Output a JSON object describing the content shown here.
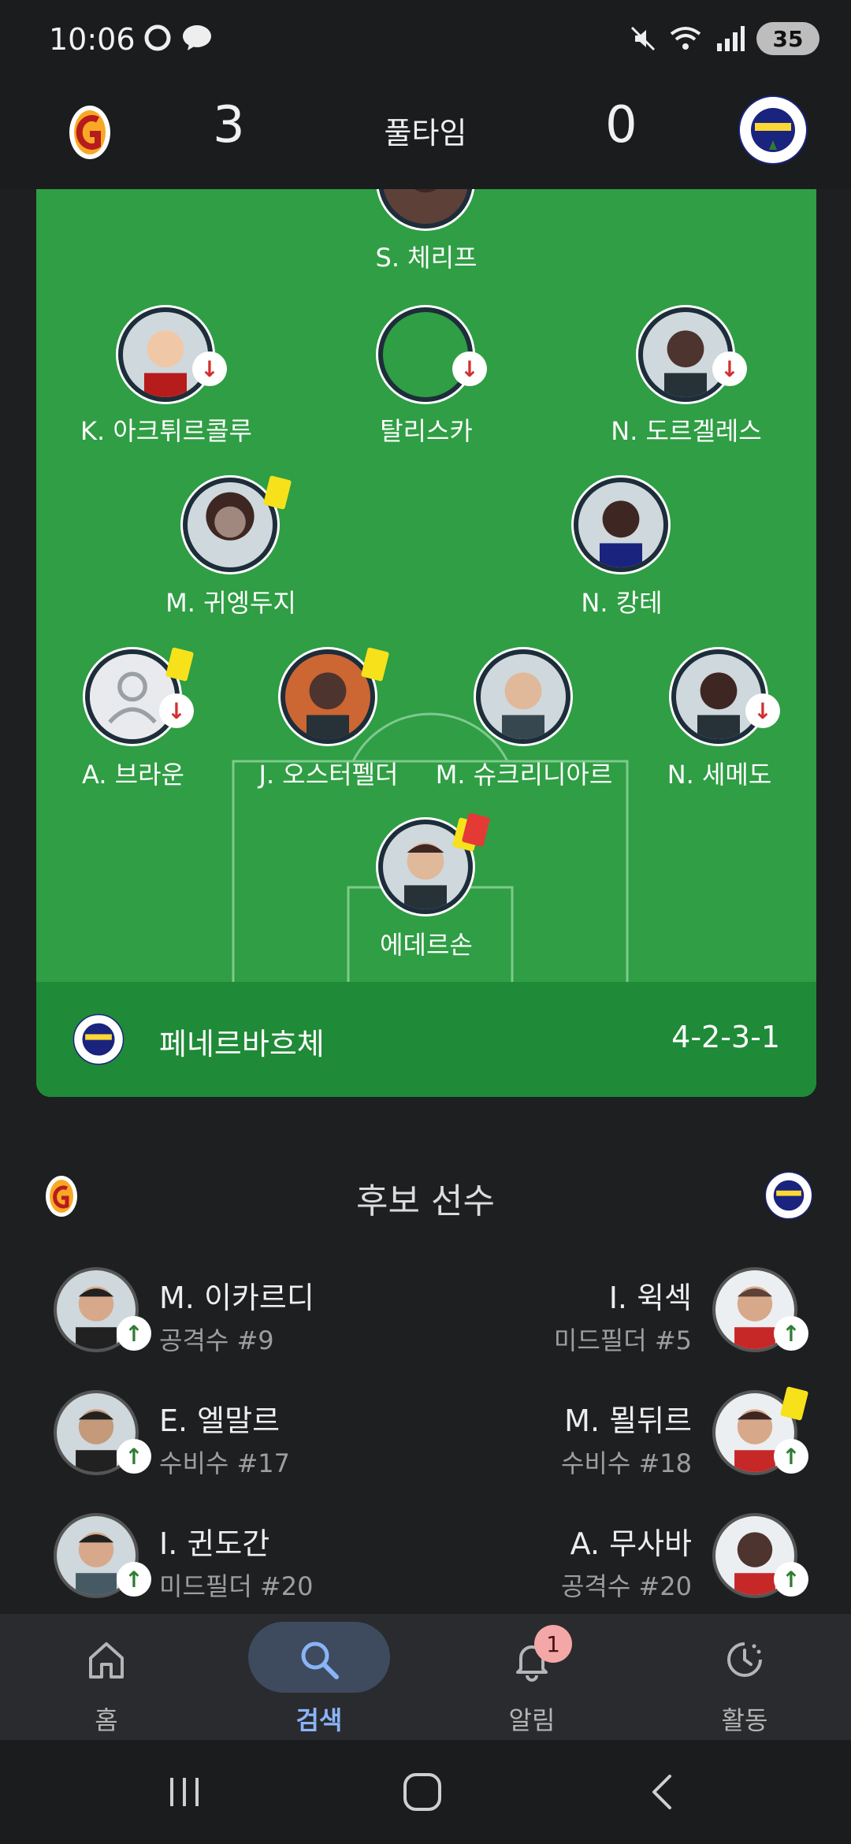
{
  "status_bar": {
    "time": "10:06",
    "battery": "35"
  },
  "match": {
    "home_score": "3",
    "away_score": "0",
    "status": "풀타임"
  },
  "lineup": {
    "team_name": "페네르바흐체",
    "formation": "4-2-3-1",
    "players": [
      {
        "name": "S. 체리프",
        "subbed_off": false,
        "card": null
      },
      {
        "name": "K. 아크튀르콜루",
        "subbed_off": true,
        "card": null
      },
      {
        "name": "탈리스카",
        "subbed_off": true,
        "card": null
      },
      {
        "name": "N. 도르겔레스",
        "subbed_off": true,
        "card": null
      },
      {
        "name": "M. 귀엥두지",
        "subbed_off": false,
        "card": "yellow"
      },
      {
        "name": "N. 캉테",
        "subbed_off": false,
        "card": null
      },
      {
        "name": "A. 브라운",
        "subbed_off": true,
        "card": "yellow"
      },
      {
        "name": "J. 오스터펠더",
        "subbed_off": false,
        "card": "yellow"
      },
      {
        "name": "M. 슈크리니아르",
        "subbed_off": false,
        "card": null
      },
      {
        "name": "N. 세메도",
        "subbed_off": true,
        "card": null
      },
      {
        "name": "에데르손",
        "subbed_off": false,
        "card": "yellow-red"
      }
    ]
  },
  "substitutes": {
    "title": "후보 선수",
    "home": [
      {
        "name": "M. 이카르디",
        "role": "공격수 #9"
      },
      {
        "name": "E. 엘말르",
        "role": "수비수 #17"
      },
      {
        "name": "I. 귄도간",
        "role": "미드필더 #20"
      }
    ],
    "away": [
      {
        "name": "I. 윅섹",
        "role": "미드필더 #5"
      },
      {
        "name": "M. 묄뒤르",
        "role": "수비수 #18"
      },
      {
        "name": "A. 무사바",
        "role": "공격수 #20"
      }
    ]
  },
  "nav": {
    "items": [
      {
        "label": "홈",
        "icon": "home-icon"
      },
      {
        "label": "검색",
        "icon": "search-icon"
      },
      {
        "label": "알림",
        "icon": "bell-icon",
        "badge": "1"
      },
      {
        "label": "활동",
        "icon": "activity-icon"
      }
    ]
  },
  "colors": {
    "pitch": "#2f9e44",
    "pitch_footer": "#1f8a37",
    "background": "#1e1f21",
    "accent": "#8ab4f8",
    "yellow_card": "#f6e11b",
    "red_card": "#e53935"
  }
}
